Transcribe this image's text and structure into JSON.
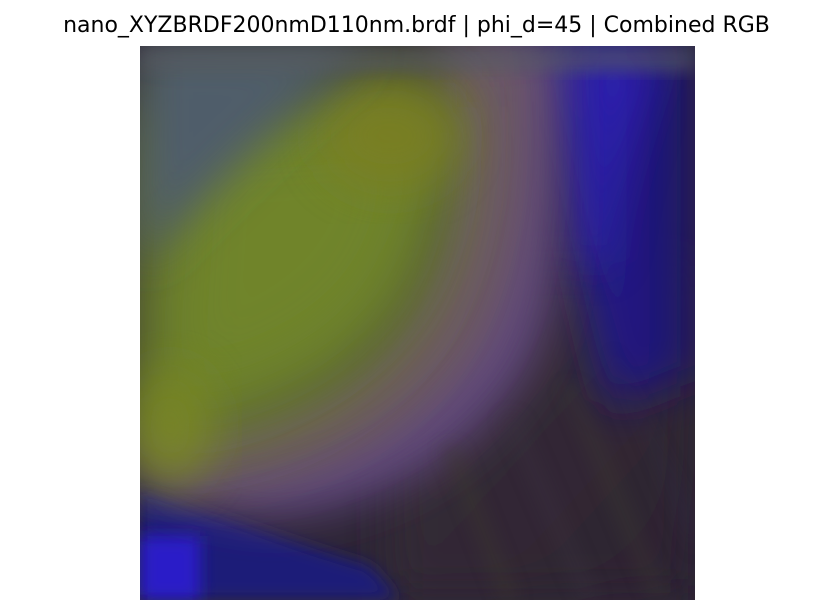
{
  "title": "nano_XYZBRDF200nmD110nm.brdf | phi_d=45 | Combined RGB",
  "image": {
    "kind": "brdf-slice-rgb",
    "colors": {
      "olive_green": "#6a7a2a",
      "yellow_green": "#7d8c24",
      "slate_gray": "#4e5e6a",
      "mauve": "#6b5565",
      "violet": "#5a3e8a",
      "deep_blue": "#1f1770",
      "bright_blue": "#2a1ad0",
      "dark_plum": "#2e2530",
      "navy": "#221a5c"
    }
  }
}
